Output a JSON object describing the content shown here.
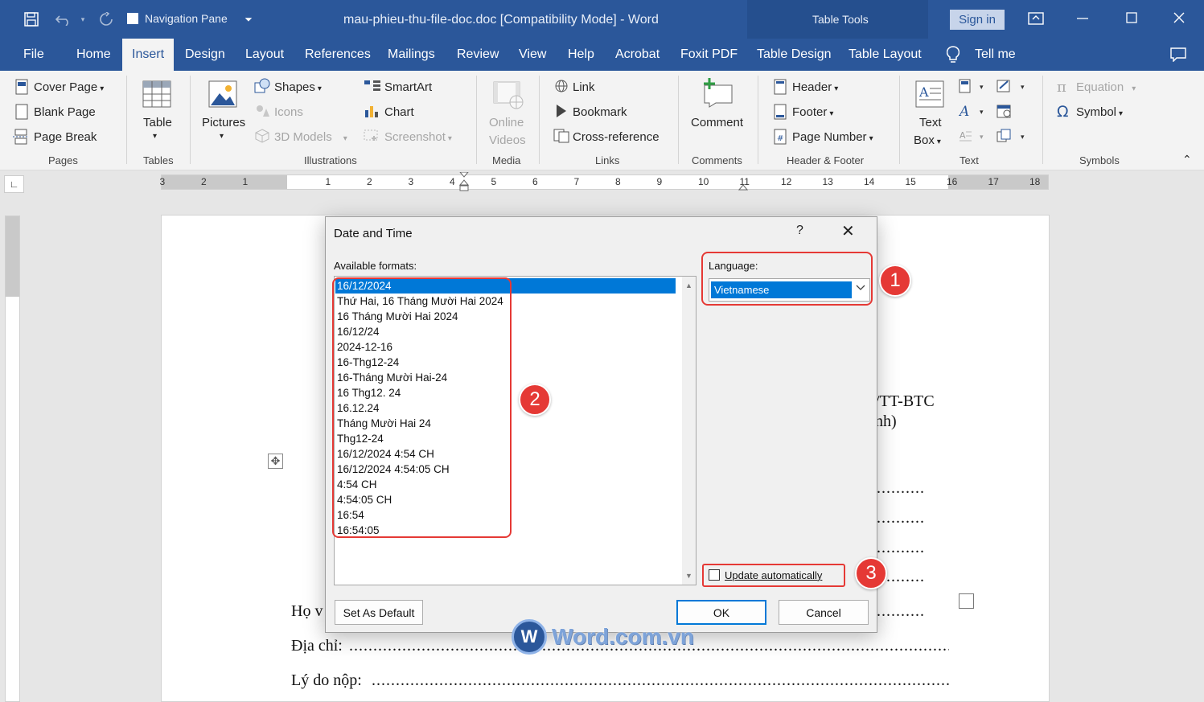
{
  "titlebar": {
    "nav_pane_label": "Navigation Pane",
    "doc_title": "mau-phieu-thu-file-doc.doc [Compatibility Mode] - Word",
    "table_tools": "Table Tools",
    "sign_in": "Sign in"
  },
  "tabs": [
    "File",
    "Home",
    "Insert",
    "Design",
    "Layout",
    "References",
    "Mailings",
    "Review",
    "View",
    "Help",
    "Acrobat",
    "Foxit PDF",
    "Table Design",
    "Table Layout"
  ],
  "tell_me": "Tell me",
  "ribbon": {
    "pages": {
      "cover_page": "Cover Page",
      "blank_page": "Blank Page",
      "page_break": "Page Break",
      "group": "Pages"
    },
    "tables": {
      "table": "Table",
      "group": "Tables"
    },
    "illustrations": {
      "pictures": "Pictures",
      "shapes": "Shapes",
      "icons": "Icons",
      "models": "3D Models",
      "smartart": "SmartArt",
      "chart": "Chart",
      "screenshot": "Screenshot",
      "group": "Illustrations"
    },
    "media": {
      "online": "Online",
      "videos": "Videos",
      "group": "Media"
    },
    "links": {
      "link": "Link",
      "bookmark": "Bookmark",
      "crossref": "Cross-reference",
      "group": "Links"
    },
    "comments": {
      "comment": "Comment",
      "group": "Comments"
    },
    "headerfooter": {
      "header": "Header",
      "footer": "Footer",
      "page_number": "Page Number",
      "group": "Header & Footer"
    },
    "text": {
      "text": "Text",
      "box": "Box",
      "group": "Text"
    },
    "symbols": {
      "equation": "Equation",
      "symbol": "Symbol",
      "group": "Symbols"
    }
  },
  "ruler": {
    "left_nums": [
      "3",
      "2",
      "1"
    ],
    "right_nums": [
      "1",
      "2",
      "3",
      "4",
      "5",
      "6",
      "7",
      "8",
      "9",
      "10",
      "11",
      "12",
      "13",
      "14",
      "15",
      "16",
      "17",
      "18"
    ]
  },
  "document": {
    "line_a": "/TT-BTC",
    "line_b": "nh)",
    "dots": "..........",
    "ho_v": "Họ v",
    "dia_chi": "Địa chỉ: ",
    "ly_do": "Lý do nộp: "
  },
  "dialog": {
    "title": "Date and Time",
    "help": "?",
    "available_label": "Available formats:",
    "language_label": "Language:",
    "language_value": "Vietnamese",
    "formats": [
      "16/12/2024",
      "Thứ Hai, 16 Tháng Mười Hai 2024",
      "16 Tháng Mười Hai 2024",
      "16/12/24",
      "2024-12-16",
      "16-Thg12-24",
      "16-Tháng Mười Hai-24",
      "16 Thg12. 24",
      "16.12.24",
      "Tháng Mười Hai 24",
      "Thg12-24",
      "16/12/2024 4:54 CH",
      "16/12/2024 4:54:05 CH",
      "4:54 CH",
      "4:54:05 CH",
      "16:54",
      "16:54:05"
    ],
    "selected_index": 0,
    "update_auto": "Update automatically",
    "update_auto_checked": false,
    "set_default": "Set As Default",
    "ok": "OK",
    "cancel": "Cancel"
  },
  "annotations": [
    "1",
    "2",
    "3"
  ],
  "watermark": {
    "logo": "W",
    "text": "Word.com.vn"
  },
  "colors": {
    "word_blue": "#2b579a",
    "selection": "#0078d7",
    "annotation_red": "#e53935"
  }
}
